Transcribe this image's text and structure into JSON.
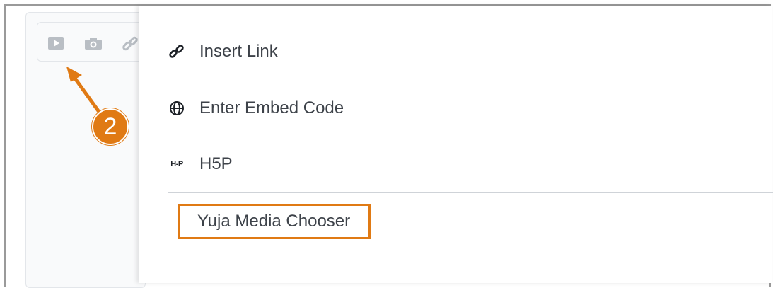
{
  "toolbar": {
    "icons": [
      "play-video-icon",
      "camera-icon",
      "link-icon"
    ]
  },
  "menu": {
    "items": [
      {
        "label": "Insert Link",
        "icon": "link-icon"
      },
      {
        "label": "Enter Embed Code",
        "icon": "globe-icon"
      },
      {
        "label": "H5P",
        "icon": "h5p-icon",
        "icon_text": "H-P"
      },
      {
        "label": "Yuja Media Chooser",
        "icon": "",
        "highlighted": true
      }
    ]
  },
  "annotation": {
    "step_number": "2",
    "color": "#e07a14"
  }
}
